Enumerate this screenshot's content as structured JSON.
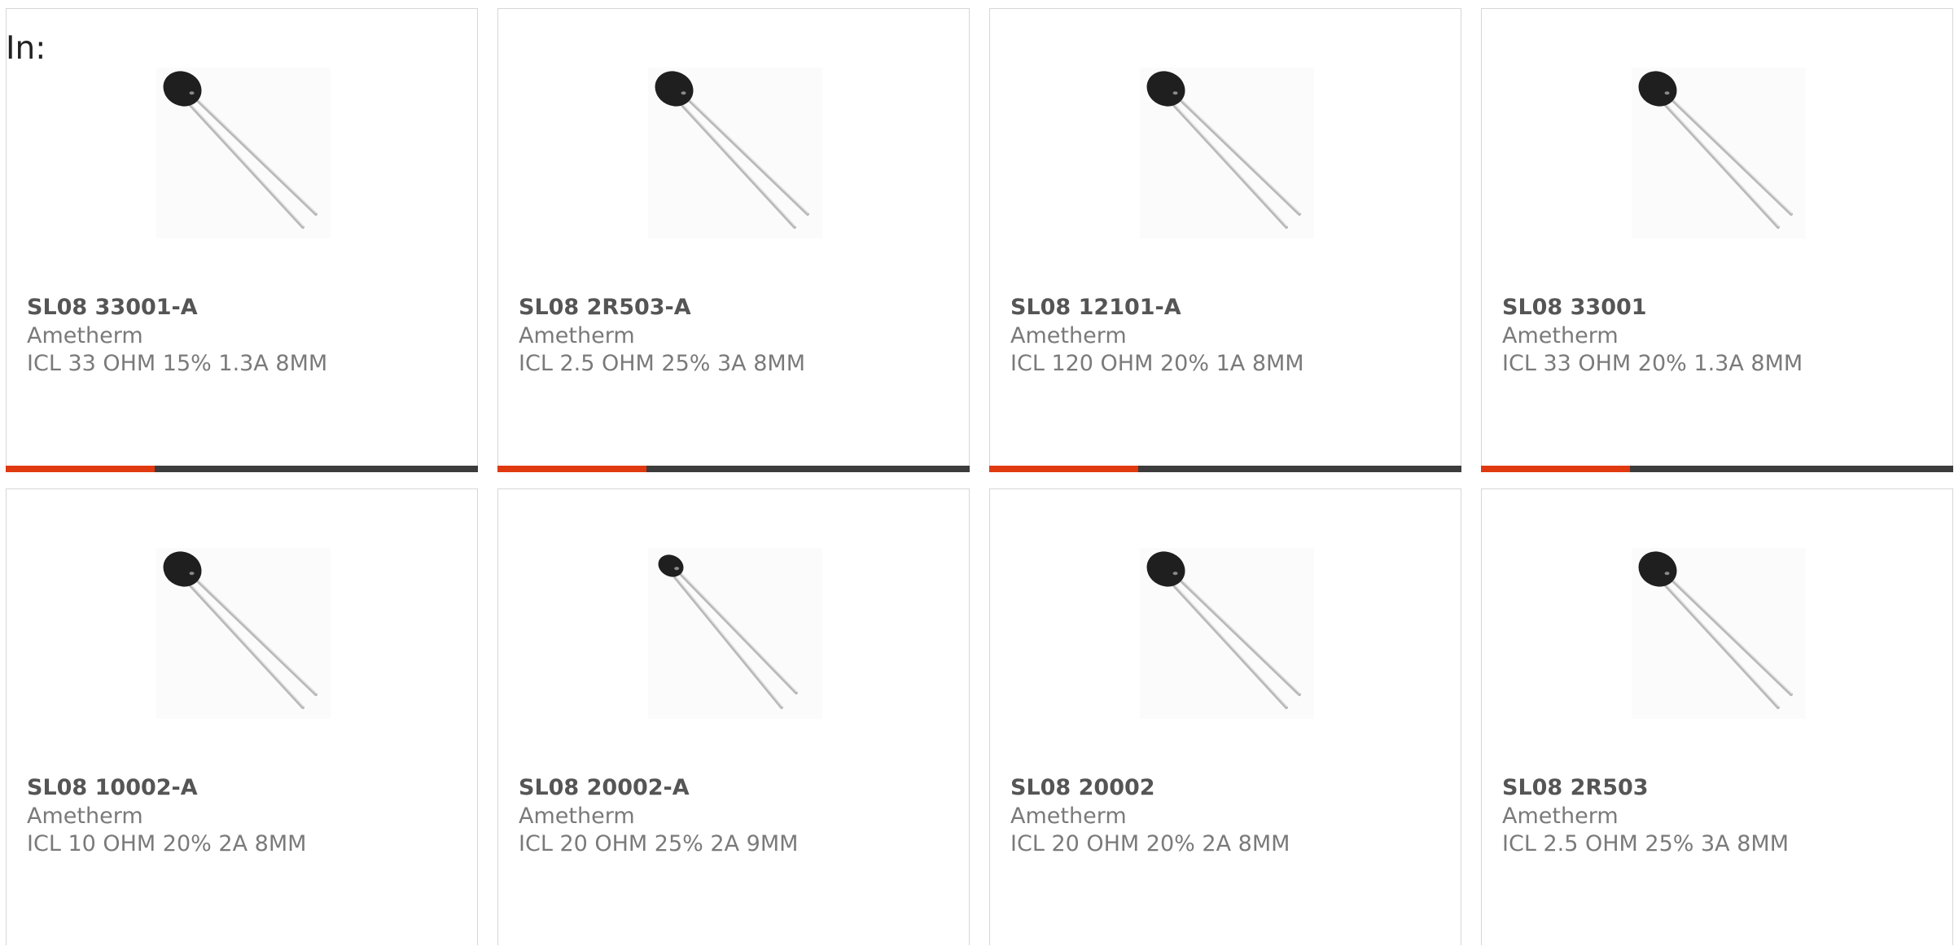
{
  "filter_label": "In:",
  "colors": {
    "accent": "#e0390f",
    "bar": "#3c3c3c",
    "border": "#d6d6d6",
    "title_text": "#555555",
    "body_text": "#7a7a7a"
  },
  "products": [
    {
      "part": "SL08 33001-A",
      "brand": "Ametherm",
      "description": "ICL 33 OHM 15% 1.3A 8MM",
      "image": "thermistor-icon"
    },
    {
      "part": "SL08 2R503-A",
      "brand": "Ametherm",
      "description": "ICL 2.5 OHM 25% 3A 8MM",
      "image": "thermistor-icon"
    },
    {
      "part": "SL08 12101-A",
      "brand": "Ametherm",
      "description": "ICL 120 OHM 20% 1A 8MM",
      "image": "thermistor-icon"
    },
    {
      "part": "SL08 33001",
      "brand": "Ametherm",
      "description": "ICL 33 OHM 20% 1.3A 8MM",
      "image": "thermistor-icon"
    },
    {
      "part": "SL08 10002-A",
      "brand": "Ametherm",
      "description": "ICL 10 OHM 20% 2A 8MM",
      "image": "thermistor-icon"
    },
    {
      "part": "SL08 20002-A",
      "brand": "Ametherm",
      "description": "ICL 20 OHM 25% 2A 9MM",
      "image": "thermistor-icon"
    },
    {
      "part": "SL08 20002",
      "brand": "Ametherm",
      "description": "ICL 20 OHM 20% 2A 8MM",
      "image": "thermistor-icon"
    },
    {
      "part": "SL08 2R503",
      "brand": "Ametherm",
      "description": "ICL 2.5 OHM 25% 3A 8MM",
      "image": "thermistor-icon"
    }
  ]
}
